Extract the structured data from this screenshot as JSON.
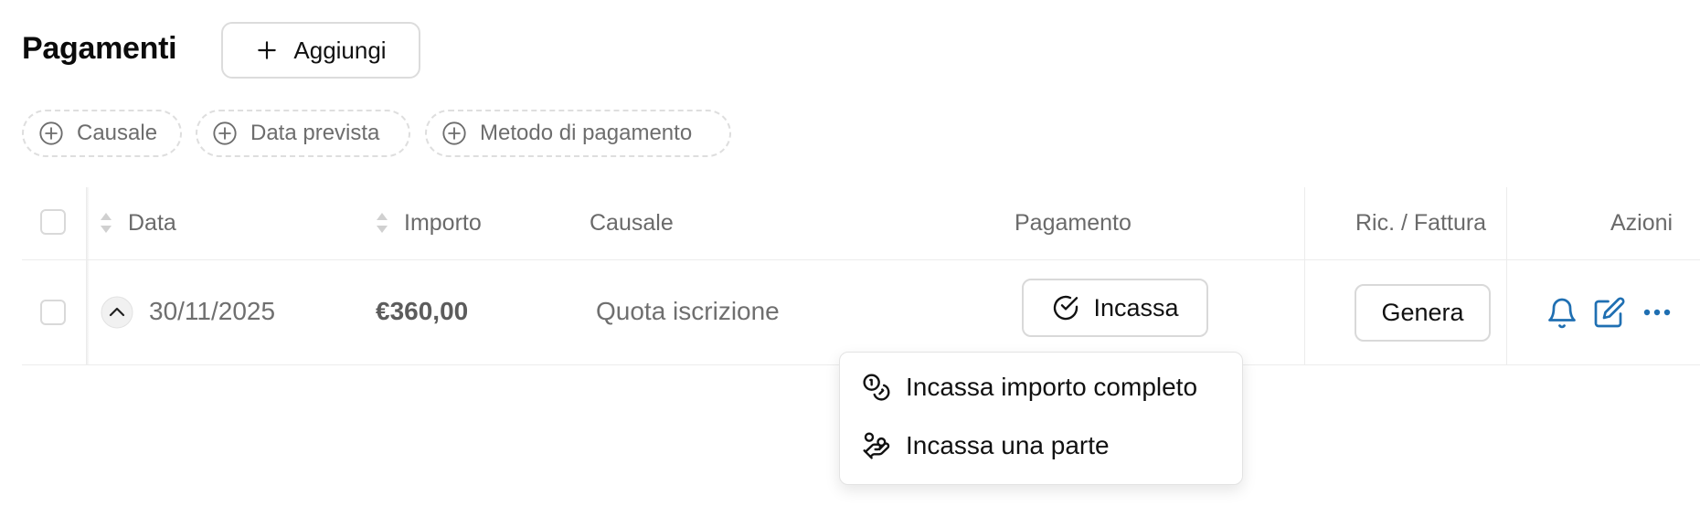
{
  "header": {
    "title": "Pagamenti",
    "add_label": "Aggiungi"
  },
  "filters": [
    {
      "label": "Causale",
      "icon": "plus-circle-icon"
    },
    {
      "label": "Data prevista",
      "icon": "plus-circle-icon"
    },
    {
      "label": "Metodo di pagamento",
      "icon": "plus-circle-icon"
    }
  ],
  "table": {
    "columns": {
      "data": "Data",
      "importo": "Importo",
      "causale": "Causale",
      "pagamento": "Pagamento",
      "ricevuta": "Ric. / Fattura",
      "azioni": "Azioni"
    },
    "rows": [
      {
        "data": "30/11/2025",
        "importo": "€360,00",
        "causale": "Quota iscrizione",
        "pagamento_button": "Incassa",
        "ricevuta_button": "Genera"
      }
    ]
  },
  "dropdown": {
    "items": [
      {
        "label": "Incassa importo completo",
        "icon": "coins-icon"
      },
      {
        "label": "Incassa una parte",
        "icon": "hand-coins-icon"
      }
    ]
  },
  "colors": {
    "accent": "#1f6fb2",
    "border": "#d9d9d9",
    "muted_text": "#6f6f6f"
  }
}
